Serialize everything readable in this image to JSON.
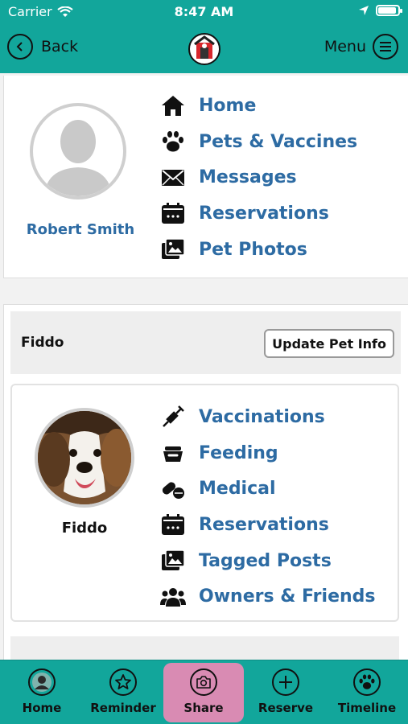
{
  "status_bar": {
    "carrier": "Carrier",
    "time": "8:47 AM",
    "battery_level": 0.92
  },
  "nav": {
    "back_label": "Back",
    "menu_label": "Menu"
  },
  "owner": {
    "name": "Robert Smith",
    "menu": [
      {
        "label": "Home",
        "icon": "home-icon"
      },
      {
        "label": "Pets & Vaccines",
        "icon": "paw-icon"
      },
      {
        "label": "Messages",
        "icon": "envelope-icon"
      },
      {
        "label": "Reservations",
        "icon": "calendar-icon"
      },
      {
        "label": "Pet Photos",
        "icon": "photos-icon"
      }
    ]
  },
  "pet": {
    "header_name": "Fiddo",
    "update_label": "Update Pet Info",
    "name": "Fiddo",
    "menu": [
      {
        "label": "Vaccinations",
        "icon": "syringe-icon"
      },
      {
        "label": "Feeding",
        "icon": "food-bowl-icon"
      },
      {
        "label": "Medical",
        "icon": "pill-icon"
      },
      {
        "label": "Reservations",
        "icon": "calendar-icon"
      },
      {
        "label": "Tagged Posts",
        "icon": "photos-icon"
      },
      {
        "label": "Owners & Friends",
        "icon": "users-icon"
      }
    ]
  },
  "tabs": [
    {
      "label": "Home",
      "icon": "user-icon"
    },
    {
      "label": "Reminder",
      "icon": "star-icon"
    },
    {
      "label": "Share",
      "icon": "camera-icon",
      "active": true
    },
    {
      "label": "Reserve",
      "icon": "plus-icon"
    },
    {
      "label": "Timeline",
      "icon": "paw-icon"
    }
  ],
  "colors": {
    "accent": "#12a69b",
    "link": "#2d6ba3",
    "active_tab": "#d98bb3"
  }
}
